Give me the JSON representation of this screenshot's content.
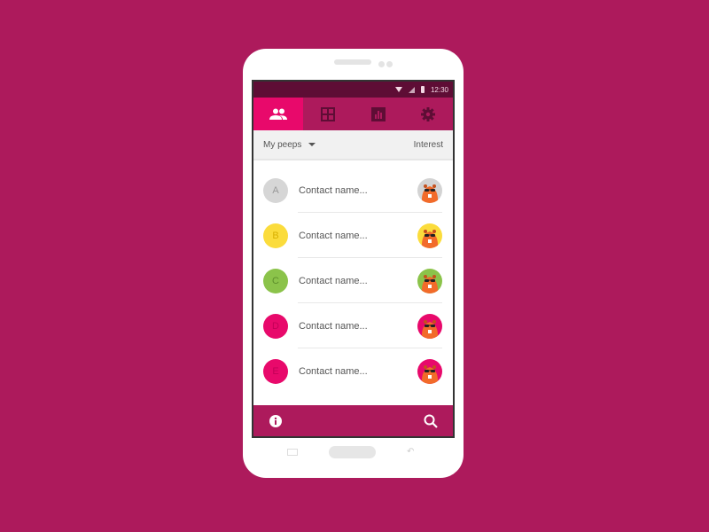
{
  "status_bar": {
    "time": "12:30",
    "icons": [
      "wifi-icon",
      "signal-icon",
      "battery-icon"
    ]
  },
  "tabs": [
    {
      "icon": "people-icon",
      "active": true
    },
    {
      "icon": "grid-icon",
      "active": false
    },
    {
      "icon": "bar-chart-icon",
      "active": false
    },
    {
      "icon": "gear-icon",
      "active": false
    }
  ],
  "filter_bar": {
    "dropdown_label": "My peeps",
    "right_label": "Interest"
  },
  "contacts": [
    {
      "letter": "A",
      "name": "Contact name...",
      "badge_color": "#d6d6d6",
      "letter_color": "#999999",
      "avatar_bg": "#d3d3d3",
      "avatar_top": "#d3d3d3"
    },
    {
      "letter": "B",
      "name": "Contact name...",
      "badge_color": "#fbdc3c",
      "letter_color": "#d8b000",
      "avatar_bg": "#fbdc3c",
      "avatar_top": "#fbdc3c"
    },
    {
      "letter": "C",
      "name": "Contact name...",
      "badge_color": "#8bc34a",
      "letter_color": "#5d8f2c",
      "avatar_bg": "#8bc34a",
      "avatar_top": "#8bc34a"
    },
    {
      "letter": "D",
      "name": "Contact name...",
      "badge_color": "#e8096b",
      "letter_color": "#c40058",
      "avatar_bg": "#e8096b",
      "avatar_top": "#e8096b"
    },
    {
      "letter": "E",
      "name": "Contact name...",
      "badge_color": "#e8096b",
      "letter_color": "#c40058",
      "avatar_bg": "#e8096b",
      "avatar_top": "#e8096b"
    }
  ],
  "bottom_bar": {
    "left_icon": "info-icon",
    "right_icon": "search-icon"
  },
  "colors": {
    "background": "#ad1a5c",
    "primary": "#ad1a5c",
    "accent": "#e8096b",
    "status_bar": "#5e0d35"
  }
}
